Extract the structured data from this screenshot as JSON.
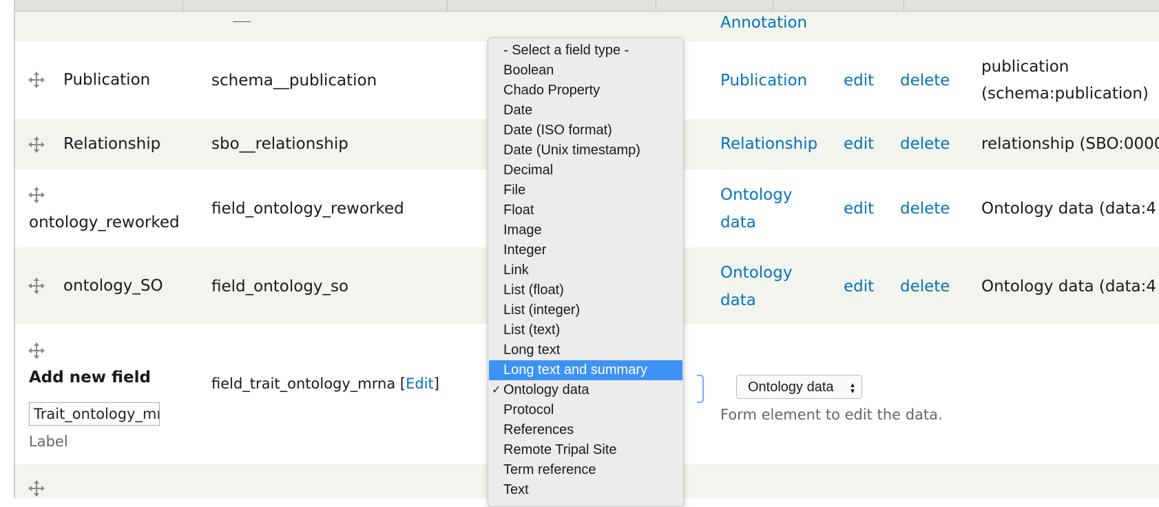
{
  "rows": [
    {
      "label": "Publication",
      "machine_name": "schema__publication",
      "widget": "Publication",
      "edit": "edit",
      "delete": "delete",
      "widget_type_line1": "publication",
      "widget_type_line2": "(schema:publication)"
    },
    {
      "label": "Relationship",
      "machine_name": "sbo__relationship",
      "widget": "Relationship",
      "edit": "edit",
      "delete": "delete",
      "widget_type": "relationship (SBO:0000"
    },
    {
      "label": "ontology_reworked",
      "machine_name": "field_ontology_reworked",
      "widget_line1": "Ontology",
      "widget_line2": "data",
      "edit": "edit",
      "delete": "delete",
      "widget_type": "Ontology data (data:4"
    },
    {
      "label": "ontology_SO",
      "machine_name": "field_ontology_so",
      "widget_line1": "Ontology",
      "widget_line2": "data",
      "edit": "edit",
      "delete": "delete",
      "widget_type": "Ontology data (data:4"
    }
  ],
  "top_row": {
    "widget": "Annotation"
  },
  "add_new": {
    "title": "Add new field",
    "label_value": "Trait_ontology_mr",
    "label_caption": "Label",
    "machine_name": "field_trait_ontology_mrna",
    "bracket_open": "[",
    "edit_link": "Edit",
    "bracket_close": "]",
    "widget_select_value": "Ontology data",
    "widget_description": "Form element to edit the data."
  },
  "field_type_dropdown": {
    "selected": "Ontology data",
    "highlighted": "Long text and summary",
    "check_mark": "✓",
    "options": [
      "- Select a field type -",
      "Boolean",
      "Chado Property",
      "Date",
      "Date (ISO format)",
      "Date (Unix timestamp)",
      "Decimal",
      "File",
      "Float",
      "Image",
      "Integer",
      "Link",
      "List (float)",
      "List (integer)",
      "List (text)",
      "Long text",
      "Long text and summary",
      "Ontology data",
      "Protocol",
      "References",
      "Remote Tripal Site",
      "Term reference",
      "Text"
    ]
  },
  "colors": {
    "link": "#0074bd",
    "highlight": "#3d92f5",
    "row_alt": "#f3f4ee",
    "header": "#e1e2dc"
  }
}
